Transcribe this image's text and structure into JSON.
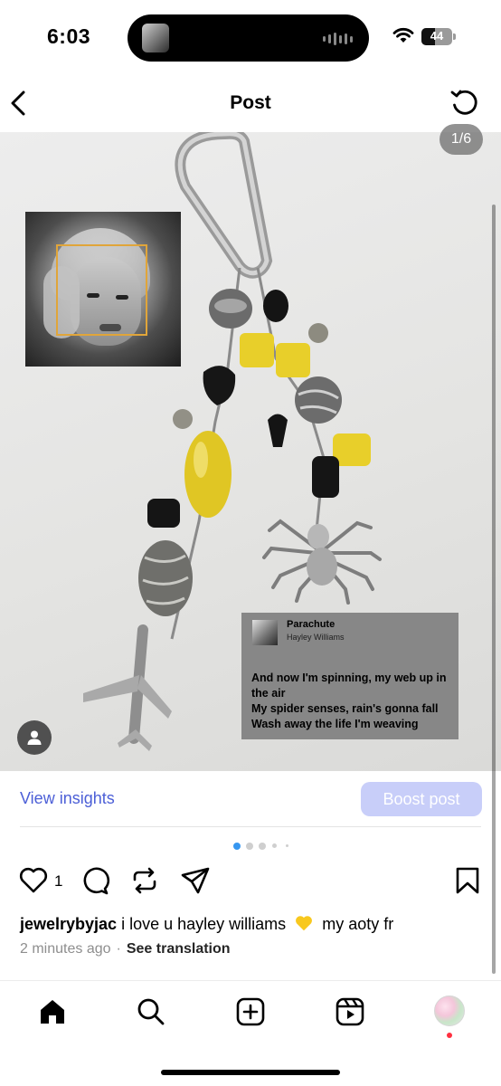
{
  "status_bar": {
    "time": "6:03",
    "battery": "44",
    "battery_level": 0.44
  },
  "header": {
    "title": "Post"
  },
  "photo": {
    "counter": "1/6",
    "lyrics_card": {
      "song": "Parachute",
      "artist": "Hayley Williams",
      "lines": [
        "And now I'm spinning, my web up in the air",
        "My spider senses, rain's gonna fall",
        "Wash away the life I'm weaving"
      ]
    }
  },
  "insights": {
    "view_label": "View insights",
    "boost_label": "Boost post"
  },
  "colors": {
    "accent_blue": "#4c5fd7",
    "boost_disabled": "#c8cef9",
    "notification_red": "#ff3040"
  },
  "actions": {
    "like_count": "1",
    "icons": [
      "heart-icon",
      "comment-icon",
      "repost-icon",
      "share-icon",
      "bookmark-icon"
    ]
  },
  "caption": {
    "username": "jewelrybyjac",
    "text_before": "i love u hayley williams",
    "text_after": "my aoty fr"
  },
  "meta": {
    "time_ago": "2 minutes ago",
    "separator": "·",
    "see_translation": "See translation"
  },
  "tab_bar": {
    "icons": [
      "home-icon",
      "search-icon",
      "create-icon",
      "reels-icon",
      "profile-avatar"
    ]
  }
}
